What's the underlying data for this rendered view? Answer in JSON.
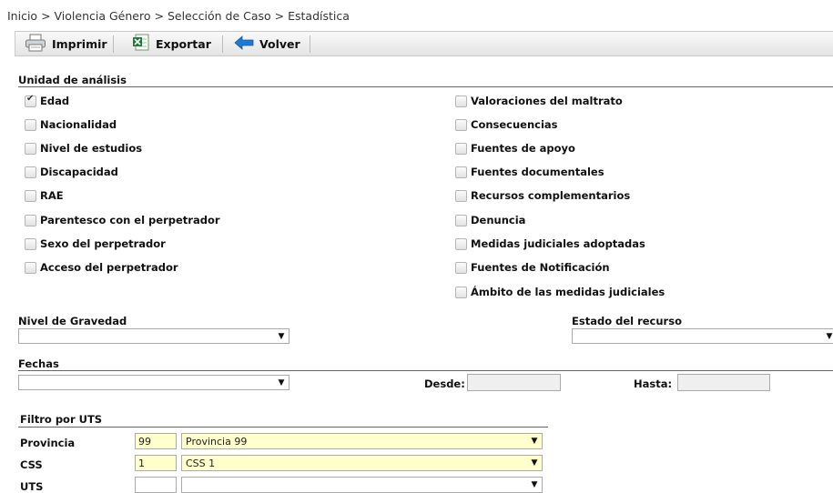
{
  "breadcrumb": {
    "items": [
      "Inicio",
      "Violencia Género",
      "Selección de Caso",
      "Estadística"
    ],
    "separator": ">"
  },
  "toolbar": {
    "print_label": "Imprimir",
    "export_label": "Exportar",
    "back_label": "Volver"
  },
  "unidad": {
    "title": "Unidad de análisis",
    "left": [
      {
        "label": "Edad",
        "checked": true
      },
      {
        "label": "Nacionalidad",
        "checked": false
      },
      {
        "label": "Nivel de estudios",
        "checked": false
      },
      {
        "label": "Discapacidad",
        "checked": false
      },
      {
        "label": "RAE",
        "checked": false
      },
      {
        "label": "Parentesco con el perpetrador",
        "checked": false
      },
      {
        "label": "Sexo del perpetrador",
        "checked": false
      },
      {
        "label": "Acceso del perpetrador",
        "checked": false
      }
    ],
    "right": [
      {
        "label": "Valoraciones del maltrato",
        "checked": false
      },
      {
        "label": "Consecuencias",
        "checked": false
      },
      {
        "label": "Fuentes de apoyo",
        "checked": false
      },
      {
        "label": "Fuentes documentales",
        "checked": false
      },
      {
        "label": "Recursos complementarios",
        "checked": false
      },
      {
        "label": "Denuncia",
        "checked": false
      },
      {
        "label": "Medidas judiciales adoptadas",
        "checked": false
      },
      {
        "label": "Fuentes de Notificación",
        "checked": false
      },
      {
        "label": "Ámbito de las medidas judiciales",
        "checked": false
      }
    ]
  },
  "gravedad": {
    "label": "Nivel de Gravedad",
    "value": ""
  },
  "estado": {
    "label": "Estado del recurso",
    "value": ""
  },
  "fechas": {
    "title": "Fechas",
    "value": "",
    "desde_label": "Desde:",
    "desde_value": "",
    "hasta_label": "Hasta:",
    "hasta_value": ""
  },
  "uts_filter": {
    "title": "Filtro por UTS",
    "rows": [
      {
        "label": "Provincia",
        "code": "99",
        "value": "Provincia 99",
        "highlight": true
      },
      {
        "label": "CSS",
        "code": "1",
        "value": "CSS 1",
        "highlight": true
      },
      {
        "label": "UTS",
        "code": "",
        "value": "",
        "highlight": false
      }
    ]
  },
  "icons": {
    "print": "printer-icon",
    "export": "excel-icon",
    "back": "arrow-left-icon",
    "dropdown": "chevron-down-icon"
  },
  "colors": {
    "highlight": "#ffffcc",
    "back_arrow": "#1f78d1",
    "excel": "#1f7a3c"
  }
}
